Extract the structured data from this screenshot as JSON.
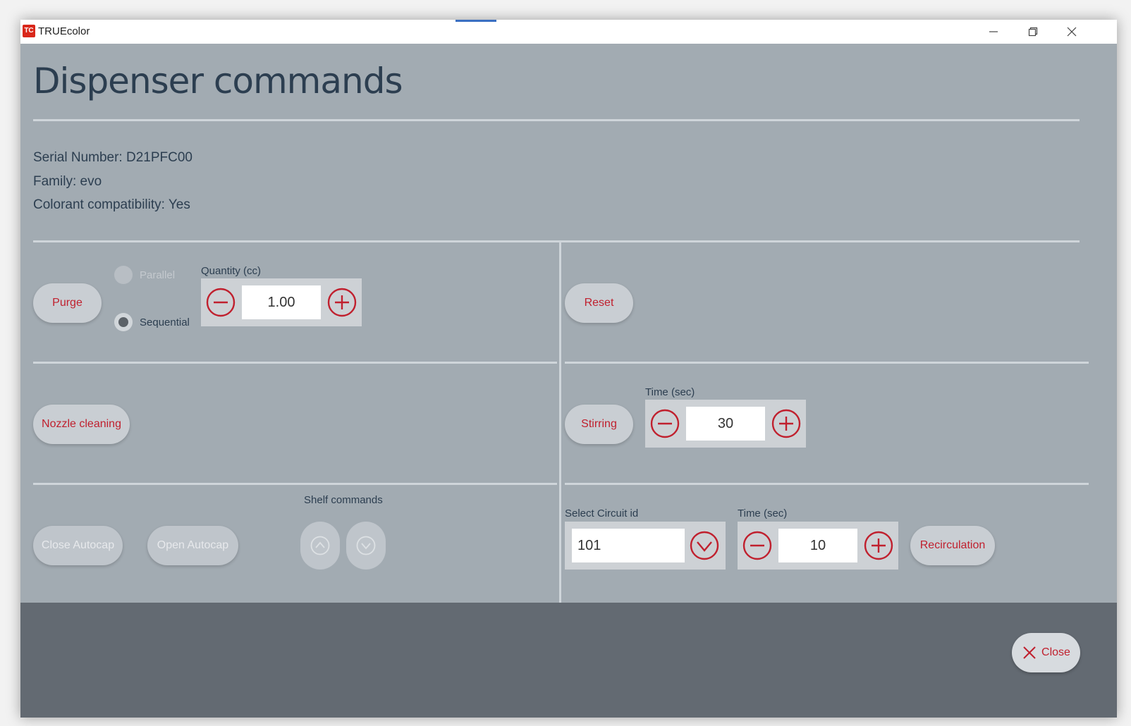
{
  "window": {
    "app_title": "TRUEcolor",
    "app_icon": "TC"
  },
  "page": {
    "title": "Dispenser commands"
  },
  "info": {
    "serial": "Serial Number: D21PFC00",
    "family": "Family: evo",
    "compat": "Colorant compatibility: Yes"
  },
  "purge": {
    "button": "Purge",
    "parallel_label": "Parallel",
    "sequential_label": "Sequential",
    "selected_mode": "Sequential",
    "quantity_label": "Quantity (cc)",
    "quantity_value": "1.00"
  },
  "reset": {
    "button": "Reset"
  },
  "nozzle": {
    "button": "Nozzle cleaning"
  },
  "stirring": {
    "button": "Stirring",
    "time_label": "Time (sec)",
    "time_value": "30"
  },
  "shelf": {
    "close_autocap": "Close Autocap",
    "open_autocap": "Open Autocap",
    "label": "Shelf commands"
  },
  "recirculation": {
    "circuit_label": "Select Circuit id",
    "circuit_value": "101",
    "time_label": "Time (sec)",
    "time_value": "10",
    "button": "Recirculation"
  },
  "footer": {
    "close": "Close"
  },
  "icons": {
    "minus": "minus-circle-icon",
    "plus": "plus-circle-icon",
    "chevron": "chevron-down-circle-icon",
    "up": "chevron-up-circle-icon",
    "close": "close-icon"
  },
  "colors": {
    "accent": "#c0202e",
    "background": "#a2abb2",
    "footer": "#636a72",
    "heading": "#2c3e50"
  }
}
